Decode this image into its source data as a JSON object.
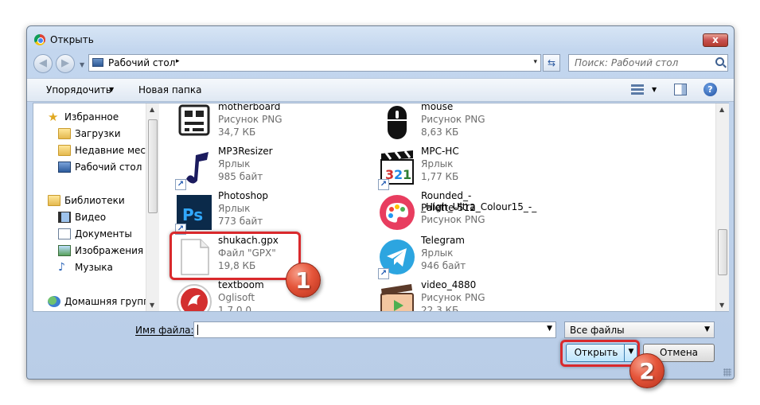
{
  "window": {
    "title": "Открыть",
    "close_glyph": "x"
  },
  "address": {
    "location": "Рабочий стол",
    "arrow": "▸",
    "drop": "▾"
  },
  "search": {
    "placeholder": "Поиск: Рабочий стол"
  },
  "toolbar": {
    "organize": "Упорядочить",
    "organize_arrow": "▼",
    "new_folder": "Новая папка",
    "view_arrow": "▼",
    "help": "?"
  },
  "nav": {
    "favorites": "Избранное",
    "downloads": "Загрузки",
    "recent": "Недавние места",
    "desktop": "Рабочий стол",
    "libraries": "Библиотеки",
    "video": "Видео",
    "documents": "Документы",
    "images": "Изображения",
    "music": "Музыка",
    "homegroup": "Домашняя группа"
  },
  "files": [
    {
      "name": "motherboard",
      "type": "Рисунок PNG",
      "size": "34,7 КБ",
      "icon": "motherboard-icon"
    },
    {
      "name": "mouse",
      "type": "Рисунок PNG",
      "size": "8,63 КБ",
      "icon": "mouse-icon"
    },
    {
      "name": "MP3Resizer",
      "type": "Ярлык",
      "size": "985 байт",
      "icon": "music-note-icon"
    },
    {
      "name": "MPC-HC",
      "type": "Ярлык",
      "size": "1,77 КБ",
      "icon": "clapperboard-icon"
    },
    {
      "name": "Photoshop",
      "type": "Ярлык",
      "size": "773 байт",
      "icon": "photoshop-icon"
    },
    {
      "name": "Rounded_-_High_Ultra_Colour15_-_",
      "name2": "Palette-512",
      "type": "Рисунок PNG",
      "icon": "palette-icon"
    },
    {
      "name": "shukach.gpx",
      "type": "Файл \"GPX\"",
      "size": "19,8 КБ",
      "icon": "blank-file-icon"
    },
    {
      "name": "Telegram",
      "type": "Ярлык",
      "size": "946 байт",
      "icon": "telegram-icon"
    },
    {
      "name": "textboom",
      "type": "Oglisoft",
      "size": "1.7.0.0",
      "icon": "textboom-icon"
    },
    {
      "name": "video_4880",
      "type": "Рисунок PNG",
      "size": "22,3 КБ",
      "icon": "video-icon"
    }
  ],
  "filename": {
    "label": "Имя файла:",
    "value": ""
  },
  "filetype": {
    "value": "Все файлы"
  },
  "buttons": {
    "open": "Открыть",
    "cancel": "Отмена",
    "drop": "▼"
  },
  "annotations": {
    "badge1": "1",
    "badge2": "2",
    "color": "#d9292c"
  },
  "colors": {
    "photoshop": "#0b2a4a",
    "photoshop_text": "#31a8ff",
    "telegram": "#2ca5e0"
  }
}
